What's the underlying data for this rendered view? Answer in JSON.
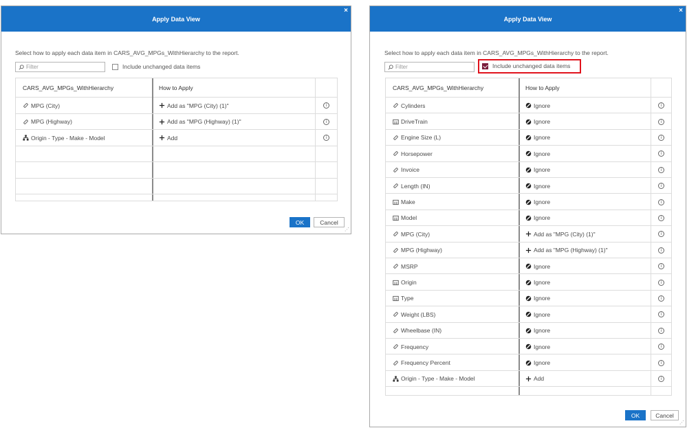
{
  "left": {
    "title": "Apply Data View",
    "close": "×",
    "instruction": "Select how to apply each data item in CARS_AVG_MPGs_WithHierarchy to the report.",
    "filter_placeholder": "Filter",
    "include_label": "Include unchanged data items",
    "include_checked": false,
    "col1": "CARS_AVG_MPGs_WithHierarchy",
    "col2": "How to Apply",
    "rows": [
      {
        "item": "MPG (City)",
        "item_icon": "measure-icon",
        "action": "Add as \"MPG (City) (1)\"",
        "action_icon": "plus-icon"
      },
      {
        "item": "MPG (Highway)",
        "item_icon": "measure-icon",
        "action": "Add as \"MPG (Highway) (1)\"",
        "action_icon": "plus-icon"
      },
      {
        "item": "Origin - Type - Make - Model",
        "item_icon": "hierarchy-icon",
        "action": "Add",
        "action_icon": "plus-icon"
      }
    ],
    "ok": "OK",
    "cancel": "Cancel"
  },
  "right": {
    "title": "Apply Data View",
    "close": "×",
    "instruction": "Select how to apply each data item in CARS_AVG_MPGs_WithHierarchy to the report.",
    "filter_placeholder": "Filter",
    "include_label": "Include unchanged data items",
    "include_checked": true,
    "col1": "CARS_AVG_MPGs_WithHierarchy",
    "col2": "How to Apply",
    "rows": [
      {
        "item": "Cylinders",
        "item_icon": "measure-icon",
        "action": "Ignore",
        "action_icon": "ignore-icon"
      },
      {
        "item": "DriveTrain",
        "item_icon": "category-icon",
        "action": "Ignore",
        "action_icon": "ignore-icon"
      },
      {
        "item": "Engine Size (L)",
        "item_icon": "measure-icon",
        "action": "Ignore",
        "action_icon": "ignore-icon"
      },
      {
        "item": "Horsepower",
        "item_icon": "measure-icon",
        "action": "Ignore",
        "action_icon": "ignore-icon"
      },
      {
        "item": "Invoice",
        "item_icon": "measure-icon",
        "action": "Ignore",
        "action_icon": "ignore-icon"
      },
      {
        "item": "Length (IN)",
        "item_icon": "measure-icon",
        "action": "Ignore",
        "action_icon": "ignore-icon"
      },
      {
        "item": "Make",
        "item_icon": "category-icon",
        "action": "Ignore",
        "action_icon": "ignore-icon"
      },
      {
        "item": "Model",
        "item_icon": "category-icon",
        "action": "Ignore",
        "action_icon": "ignore-icon"
      },
      {
        "item": "MPG (City)",
        "item_icon": "measure-icon",
        "action": "Add as \"MPG (City) (1)\"",
        "action_icon": "plus-icon"
      },
      {
        "item": "MPG (Highway)",
        "item_icon": "measure-icon",
        "action": "Add as \"MPG (Highway) (1)\"",
        "action_icon": "plus-icon"
      },
      {
        "item": "MSRP",
        "item_icon": "measure-icon",
        "action": "Ignore",
        "action_icon": "ignore-icon"
      },
      {
        "item": "Origin",
        "item_icon": "category-icon",
        "action": "Ignore",
        "action_icon": "ignore-icon"
      },
      {
        "item": "Type",
        "item_icon": "category-icon",
        "action": "Ignore",
        "action_icon": "ignore-icon"
      },
      {
        "item": "Weight (LBS)",
        "item_icon": "measure-icon",
        "action": "Ignore",
        "action_icon": "ignore-icon"
      },
      {
        "item": "Wheelbase (IN)",
        "item_icon": "measure-icon",
        "action": "Ignore",
        "action_icon": "ignore-icon"
      },
      {
        "item": "Frequency",
        "item_icon": "measure-icon",
        "action": "Ignore",
        "action_icon": "ignore-icon"
      },
      {
        "item": "Frequency Percent",
        "item_icon": "measure-icon",
        "action": "Ignore",
        "action_icon": "ignore-icon"
      },
      {
        "item": "Origin - Type - Make - Model",
        "item_icon": "hierarchy-icon",
        "action": "Add",
        "action_icon": "plus-icon"
      }
    ],
    "ok": "OK",
    "cancel": "Cancel"
  },
  "colors": {
    "titlebar": "#1a73c8",
    "highlight": "#e0121c",
    "checkbox_checked": "#7a1f3d"
  }
}
